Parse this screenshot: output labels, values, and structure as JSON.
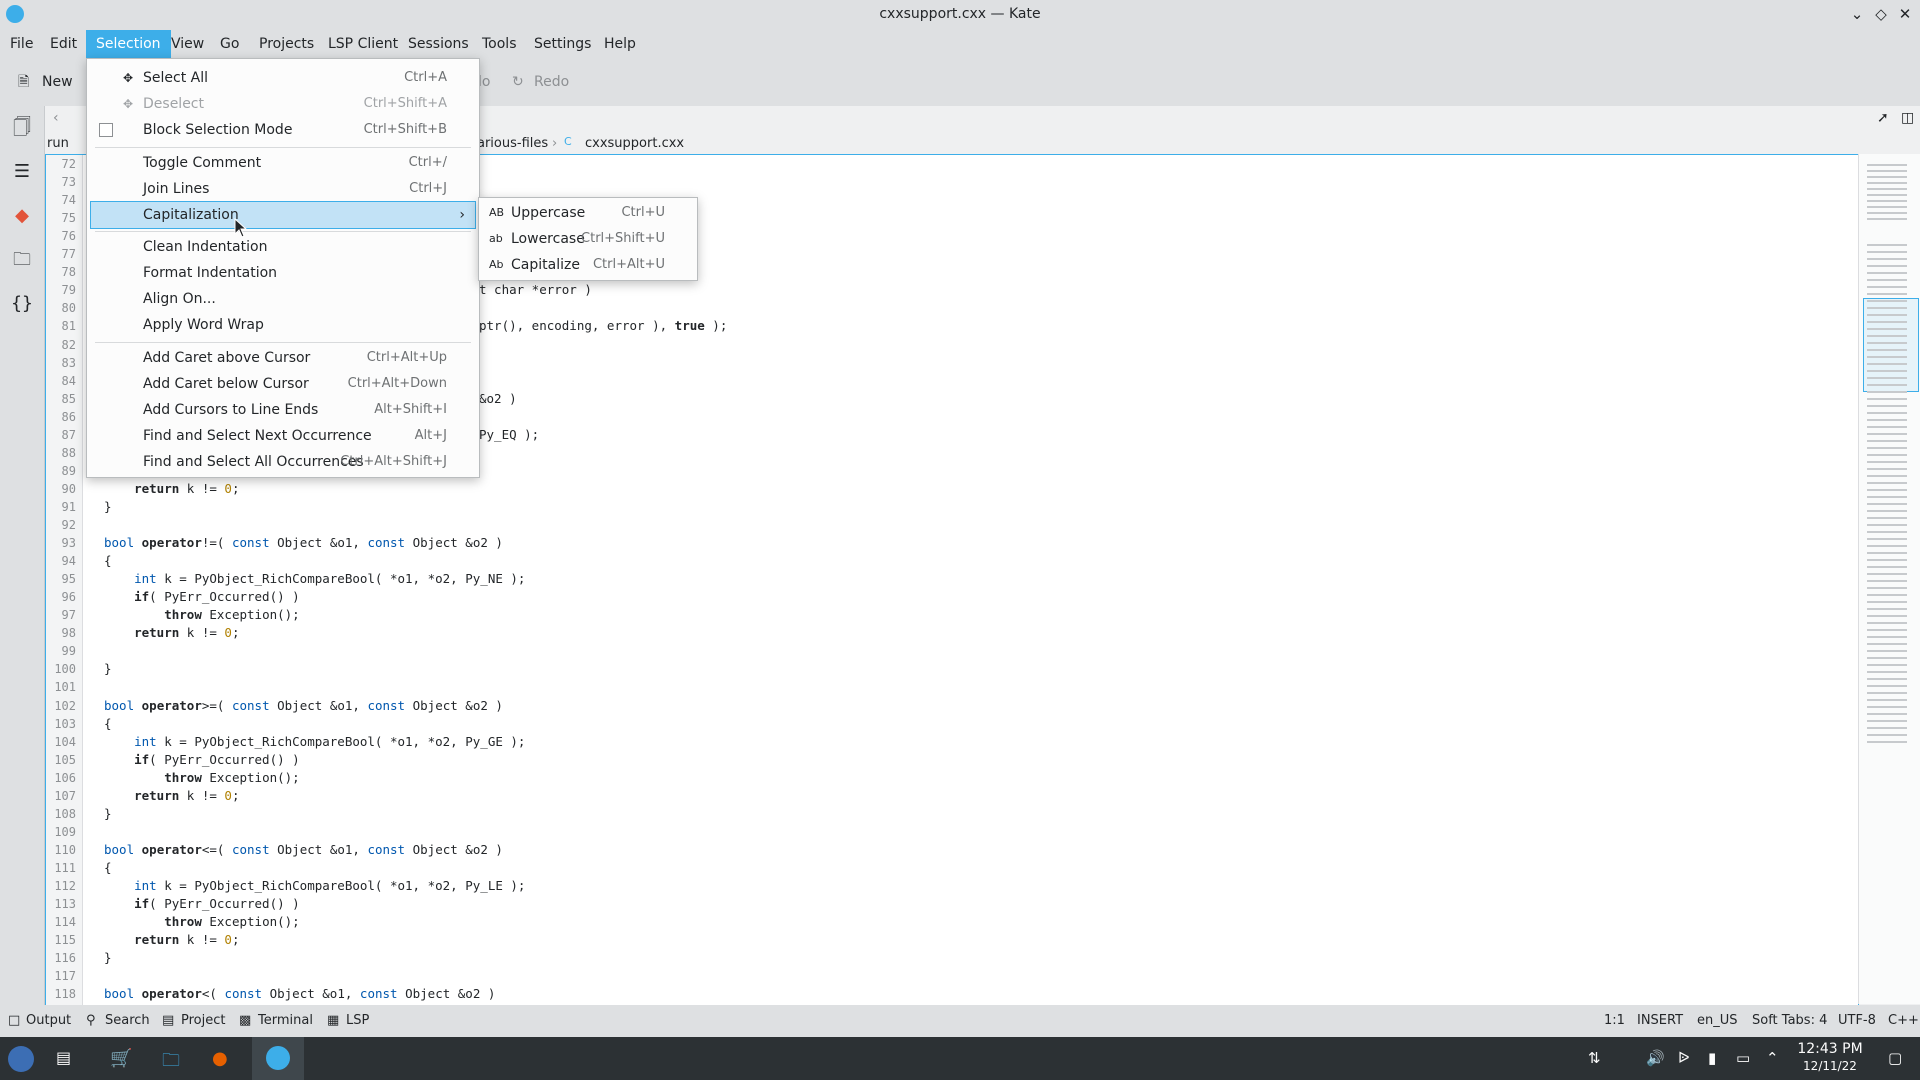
{
  "window": {
    "title": "cxxsupport.cxx — Kate"
  },
  "menubar": {
    "items": [
      "File",
      "Edit",
      "Selection",
      "View",
      "Go",
      "Projects",
      "LSP Client",
      "Sessions",
      "Tools",
      "Settings",
      "Help"
    ]
  },
  "toolbar": {
    "new_label": "New",
    "undo_label": "lo",
    "redo_label": "Redo"
  },
  "breadcrumb": {
    "root": "run",
    "folder": "arious-files",
    "file": "cxxsupport.cxx"
  },
  "selection_menu": {
    "items": [
      {
        "label": "Select All",
        "shortcut": "Ctrl+A",
        "icon": "select-all-icon"
      },
      {
        "label": "Deselect",
        "shortcut": "Ctrl+Shift+A",
        "icon": "deselect-icon",
        "disabled": true
      },
      {
        "label": "Block Selection Mode",
        "shortcut": "Ctrl+Shift+B",
        "checkbox": true
      },
      {
        "label": "Toggle Comment",
        "shortcut": "Ctrl+/"
      },
      {
        "label": "Join Lines",
        "shortcut": "Ctrl+J"
      },
      {
        "label": "Capitalization",
        "submenu": true
      },
      {
        "label": "Clean Indentation"
      },
      {
        "label": "Format Indentation"
      },
      {
        "label": "Align On..."
      },
      {
        "label": "Apply Word Wrap"
      },
      {
        "label": "Add Caret above Cursor",
        "shortcut": "Ctrl+Alt+Up"
      },
      {
        "label": "Add Caret below Cursor",
        "shortcut": "Ctrl+Alt+Down"
      },
      {
        "label": "Add Cursors to Line Ends",
        "shortcut": "Alt+Shift+I"
      },
      {
        "label": "Find and Select Next Occurrence",
        "shortcut": "Alt+J"
      },
      {
        "label": "Find and Select All Occurrences",
        "shortcut": "Ctrl+Alt+Shift+J"
      }
    ]
  },
  "capitalization_menu": {
    "items": [
      {
        "label": "Uppercase",
        "shortcut": "Ctrl+U",
        "icon_text": "AB"
      },
      {
        "label": "Lowercase",
        "shortcut": "Ctrl+Shift+U",
        "icon_text": "ab"
      },
      {
        "label": "Capitalize",
        "shortcut": "Ctrl+Alt+U",
        "icon_text": "Ab"
      }
    ]
  },
  "code": {
    "line_numbers": [
      "72",
      "73",
      "74",
      "75",
      "76",
      "77",
      "78",
      "79",
      "80",
      "81",
      "82",
      "83",
      "84",
      "85",
      "86",
      "87",
      "88",
      "89",
      "90",
      "91",
      "92",
      "93",
      "94",
      "95",
      "96",
      "97",
      "98",
      "99",
      "100",
      "101",
      "102",
      "103",
      "104",
      "105",
      "106",
      "107",
      "108",
      "109",
      "110",
      "111",
      "112",
      "113",
      "114",
      "115",
      "116",
      "117",
      "118"
    ],
    "visible_fragments": {
      "l79": "t char *error )",
      "l81": "ptr(), encoding, error ), true );",
      "l85": "&o2 )",
      "l87": "Py_EQ );"
    },
    "lines": {
      "l90": "    return k != 0;",
      "l91": "}",
      "l93": "bool operator!=( const Object &o1, const Object &o2 )",
      "l94": "{",
      "l95": "    int k = PyObject_RichCompareBool( *o1, *o2, Py_NE );",
      "l96": "    if( PyErr_Occurred() )",
      "l97": "        throw Exception();",
      "l98": "    return k != 0;",
      "l100": "}",
      "l102": "bool operator>=( const Object &o1, const Object &o2 )",
      "l103": "{",
      "l104": "    int k = PyObject_RichCompareBool( *o1, *o2, Py_GE );",
      "l105": "    if( PyErr_Occurred() )",
      "l106": "        throw Exception();",
      "l107": "    return k != 0;",
      "l108": "}",
      "l110": "bool operator<=( const Object &o1, const Object &o2 )",
      "l111": "{",
      "l112": "    int k = PyObject_RichCompareBool( *o1, *o2, Py_LE );",
      "l113": "    if( PyErr_Occurred() )",
      "l114": "        throw Exception();",
      "l115": "    return k != 0;",
      "l116": "}",
      "l118": "bool operator<( const Object &o1, const Object &o2 )"
    }
  },
  "statusbar": {
    "tabs": [
      "Output",
      "Search",
      "Project",
      "Terminal",
      "LSP"
    ],
    "cursor": "1:1",
    "mode": "INSERT",
    "dictionary": "en_US",
    "indent": "Soft Tabs: 4",
    "encoding": "UTF-8",
    "language": "C++"
  },
  "taskbar": {
    "time": "12:43 PM",
    "date": "12/11/22"
  },
  "colors": {
    "accent": "#3daee9",
    "highlight": "#c2e2f6"
  }
}
